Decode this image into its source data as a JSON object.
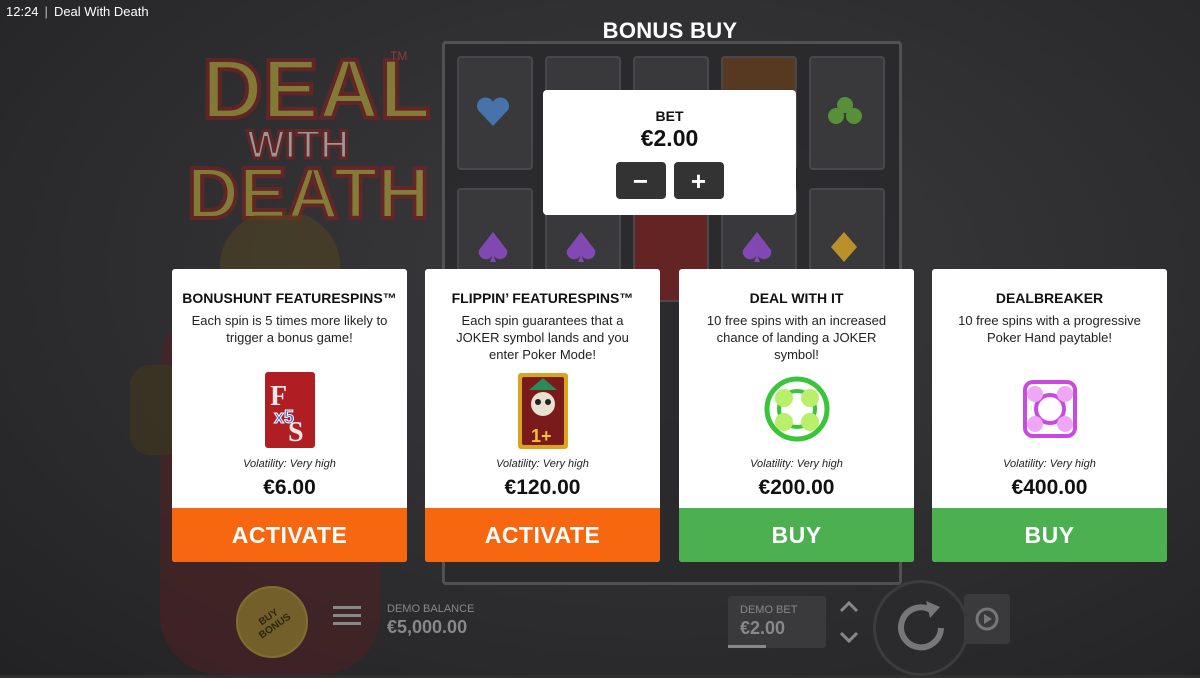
{
  "status": {
    "time": "12:24",
    "title": "Deal With Death"
  },
  "logo": {
    "text_line1": "DEAL",
    "text_line2": "WITH",
    "text_line3": "DEATH",
    "tm": "TM"
  },
  "header": {
    "title": "BONUS BUY"
  },
  "bet": {
    "label": "BET",
    "value": "€2.00",
    "minus": "−",
    "plus": "+"
  },
  "cards": [
    {
      "title": "BONUSHUNT FEATURESPINS™",
      "description": "Each spin is 5 times more likely to trigger a bonus game!",
      "volatility": "Volatility: Very high",
      "price": "€6.00",
      "action": "ACTIVATE",
      "icon": "x5-card-icon"
    },
    {
      "title": "FLIPPIN’ FEATURESPINS™",
      "description": "Each spin guarantees that a JOKER symbol lands and you enter Poker Mode!",
      "volatility": "Volatility: Very high",
      "price": "€120.00",
      "action": "ACTIVATE",
      "icon": "joker-card-icon"
    },
    {
      "title": "DEAL WITH IT",
      "description": "10 free spins with an increased chance of landing a JOKER symbol!",
      "volatility": "Volatility: Very high",
      "price": "€200.00",
      "action": "BUY",
      "icon": "green-skulls-icon"
    },
    {
      "title": "DEALBREAKER",
      "description": "10 free spins with a progressive Poker Hand paytable!",
      "volatility": "Volatility: Very high",
      "price": "€400.00",
      "action": "BUY",
      "icon": "purple-skulls-icon"
    }
  ],
  "controls": {
    "buy_bonus": "BUY BONUS",
    "balance_label": "DEMO BALANCE",
    "balance_value": "€5,000.00",
    "bet_label": "DEMO BET",
    "bet_value": "€2.00"
  },
  "colors": {
    "activate": "#f7670f",
    "buy": "#4caf50"
  }
}
